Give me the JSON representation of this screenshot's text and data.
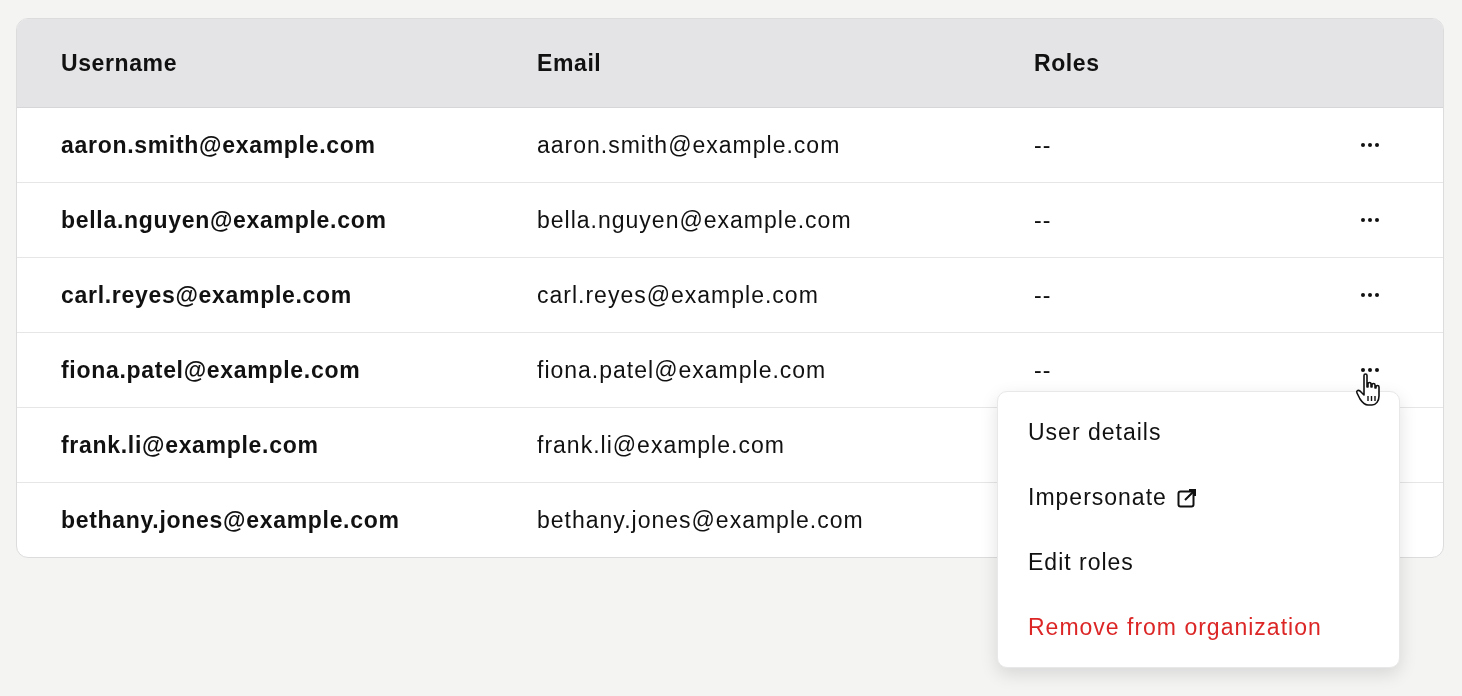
{
  "table": {
    "columns": [
      "Username",
      "Email",
      "Roles"
    ],
    "rows": [
      {
        "username": "aaron.smith@example.com",
        "email": "aaron.smith@example.com",
        "roles": "--",
        "menu_open": false
      },
      {
        "username": "bella.nguyen@example.com",
        "email": "bella.nguyen@example.com",
        "roles": "--",
        "menu_open": false
      },
      {
        "username": "carl.reyes@example.com",
        "email": "carl.reyes@example.com",
        "roles": "--",
        "menu_open": false
      },
      {
        "username": "fiona.patel@example.com",
        "email": "fiona.patel@example.com",
        "roles": "--",
        "menu_open": true
      },
      {
        "username": "frank.li@example.com",
        "email": "frank.li@example.com"
      },
      {
        "username": "bethany.jones@example.com",
        "email": "bethany.jones@example.com"
      }
    ]
  },
  "row_menu": {
    "items": [
      {
        "label": "User details",
        "kind": "default"
      },
      {
        "label": "Impersonate",
        "kind": "external"
      },
      {
        "label": "Edit roles",
        "kind": "default"
      },
      {
        "label": "Remove from organization",
        "kind": "danger"
      }
    ]
  }
}
